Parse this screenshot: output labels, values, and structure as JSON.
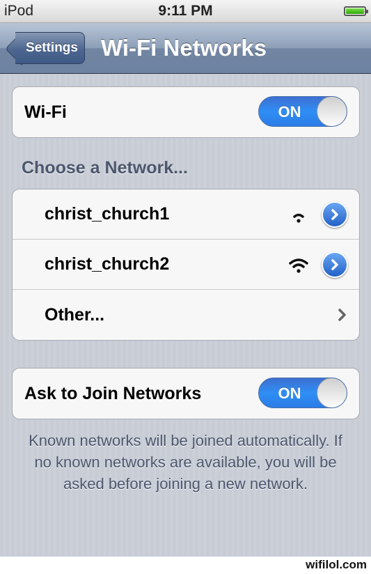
{
  "status_bar": {
    "carrier": "iPod",
    "time": "9:11 PM",
    "battery_level": 1.0
  },
  "nav": {
    "back_label": "Settings",
    "title": "Wi-Fi Networks"
  },
  "wifi_row": {
    "label": "Wi-Fi",
    "switch": "ON"
  },
  "networks_header": "Choose a Network...",
  "networks": [
    {
      "name": "christ_church1",
      "signal_bars": 2
    },
    {
      "name": "christ_church2",
      "signal_bars": 3
    }
  ],
  "other_label": "Other...",
  "ask_row": {
    "label": "Ask to Join Networks",
    "switch": "ON"
  },
  "footer_note": "Known networks will be joined automatically. If no known networks are available, you will be asked before joining a new network.",
  "watermark": "wifilol.com",
  "colors": {
    "accent": "#2f8ef5",
    "nav": "#7286a3",
    "section_text": "#4c566c"
  }
}
